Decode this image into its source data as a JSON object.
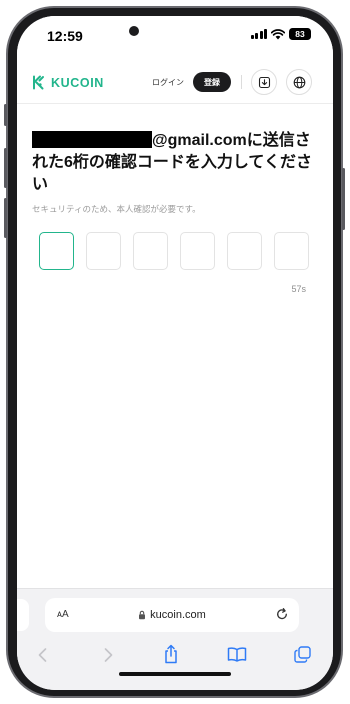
{
  "status_bar": {
    "time": "12:59",
    "battery": "83"
  },
  "header": {
    "logo_text": "KUCOIN",
    "login_label": "ログイン",
    "register_label": "登録",
    "download_icon": "download-icon",
    "language_icon": "globe-icon",
    "accent_color": "#22b58c"
  },
  "verification": {
    "email_suffix": "@gmail.comに送信された6桁の確認コードを入力してください",
    "subtext": "セキュリティのため、本人確認が必要です。",
    "code_boxes": [
      "",
      "",
      "",
      "",
      "",
      ""
    ],
    "active_box": 1,
    "timer": "57s"
  },
  "browser": {
    "text_size_label": "ᴀA",
    "url": "kucoin.com",
    "lock_icon": "lock-icon",
    "reload_icon": "reload-icon",
    "toolbar": [
      "back-icon",
      "forward-icon",
      "share-icon",
      "bookmarks-icon",
      "tabs-icon"
    ]
  }
}
